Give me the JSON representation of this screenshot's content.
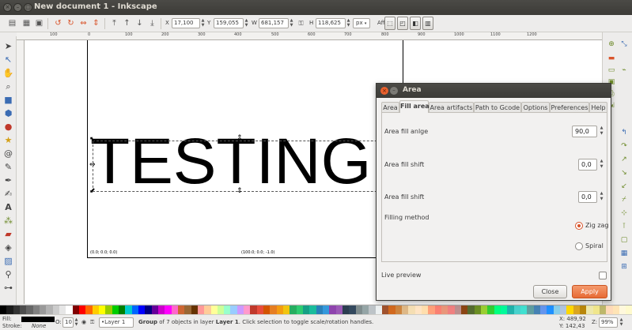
{
  "window": {
    "title": "New document 1 - Inkscape",
    "close_glyph": "×",
    "minimize_glyph": "–",
    "maximize_glyph": "□"
  },
  "controls": {
    "x_label": "X",
    "x_value": "17,100",
    "y_label": "Y",
    "y_value": "159,055",
    "w_label": "W",
    "w_value": "681,157",
    "h_label": "H",
    "h_value": "118,625",
    "unit": "px",
    "affect_label": "Affect:"
  },
  "ruler_ticks": [
    "100",
    "0",
    "100",
    "200",
    "300",
    "400",
    "500",
    "600",
    "700",
    "800",
    "900",
    "1000",
    "1100",
    "1200"
  ],
  "canvas": {
    "text": "TESTING",
    "coord_left": "(0.0; 0.0; 0.0)",
    "coord_right": "(100.0; 0.0; -1.0)"
  },
  "dialog": {
    "title": "Area",
    "tabs": [
      "Area",
      "Fill area",
      "Area artifacts",
      "Path to Gcode",
      "Options",
      "Preferences",
      "Help"
    ],
    "active_tab": "Fill area",
    "fields": {
      "fill_angle_label": "Area fill anlge",
      "fill_angle_value": "90,0",
      "fill_shift_label": "Area fill shift",
      "fill_shift_value": "0,0",
      "fill_shift2_label": "Area fill shift",
      "fill_shift2_value": "0,0",
      "filling_method_label": "Filling method",
      "zigzag_label": "Zig zag",
      "spiral_label": "Spiral"
    },
    "live_preview_label": "Live preview",
    "close_label": "Close",
    "apply_label": "Apply"
  },
  "status": {
    "fill_label": "Fill:",
    "stroke_label": "Stroke:",
    "stroke_value": "None",
    "opacity_label": "O:",
    "opacity_value": "10",
    "layer": "•Layer 1",
    "message_strong": "Group",
    "message_mid": " of 7 objects in layer ",
    "message_layer": "Layer 1",
    "message_tail": ". Click selection to toggle scale/rotation handles.",
    "x_readout": "X: 489,92",
    "y_readout": "Y: 142,43",
    "zoom_label": "Z:",
    "zoom_value": "99%"
  },
  "colors": {
    "accent": "#e76a34",
    "palette": [
      "#000000",
      "#1a1a1a",
      "#333333",
      "#4d4d4d",
      "#666666",
      "#808080",
      "#999999",
      "#b3b3b3",
      "#cccccc",
      "#e6e6e6",
      "#ffffff",
      "#800000",
      "#ff0000",
      "#ff6600",
      "#ffcc00",
      "#ffff00",
      "#99cc00",
      "#00cc00",
      "#008000",
      "#00cccc",
      "#0066ff",
      "#0000ff",
      "#000080",
      "#660099",
      "#cc00cc",
      "#ff00ff",
      "#ff66cc",
      "#cc6633",
      "#996633",
      "#663300",
      "#ff9999",
      "#ffcc99",
      "#ffff99",
      "#ccff99",
      "#99ffcc",
      "#99ccff",
      "#cc99ff",
      "#ff99cc",
      "#c0392b",
      "#e74c3c",
      "#d35400",
      "#e67e22",
      "#f39c12",
      "#f1c40f",
      "#27ae60",
      "#2ecc71",
      "#16a085",
      "#1abc9c",
      "#2980b9",
      "#3498db",
      "#8e44ad",
      "#9b59b6",
      "#2c3e50",
      "#34495e",
      "#7f8c8d",
      "#95a5a6",
      "#bdc3c7",
      "#ecf0f1",
      "#a0522d",
      "#d2691e",
      "#cd853f",
      "#deb887",
      "#f5deb3",
      "#ffe4c4",
      "#ffdead",
      "#ffa07a",
      "#fa8072",
      "#e9967a",
      "#f08080",
      "#bc8f8f",
      "#8b4513",
      "#556b2f",
      "#6b8e23",
      "#9acd32",
      "#32cd32",
      "#00ff7f",
      "#00fa9a",
      "#20b2aa",
      "#48d1cc",
      "#40e0d0",
      "#5f9ea0",
      "#4682b4",
      "#6495ed",
      "#1e90ff",
      "#87ceeb",
      "#b0c4de",
      "#ffd700",
      "#daa520",
      "#b8860b",
      "#eee8aa",
      "#f0e68c",
      "#bdb76b",
      "#ffdab9",
      "#ffe4b5",
      "#fff8dc",
      "#fffacd"
    ]
  }
}
